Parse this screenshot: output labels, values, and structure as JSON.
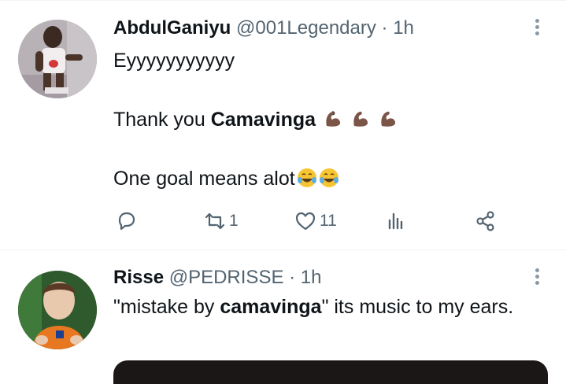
{
  "tweets": [
    {
      "name": "AbdulGaniyu",
      "handle": "@001Legendary",
      "dot": "·",
      "time": "1h",
      "line1": "Eyyyyyyyyyyy",
      "line2_prefix": "Thank you ",
      "line2_bold": "Camavinga",
      "line3": "One goal means alot",
      "retweet_count": "1",
      "like_count": "11"
    },
    {
      "name": "Risse",
      "handle": "@PEDRISSE",
      "dot": "·",
      "time": "1h",
      "text_prefix": "\"mistake by ",
      "text_bold": "camavinga",
      "text_suffix": "\" its music to my ears."
    }
  ],
  "icons": [
    "flexed-biceps-emoji",
    "joy-emoji",
    "reply-icon",
    "retweet-icon",
    "like-icon",
    "views-icon",
    "share-icon",
    "more-icon"
  ],
  "colors": {
    "secondary_text": "#536471",
    "border": "#eff3f4"
  }
}
